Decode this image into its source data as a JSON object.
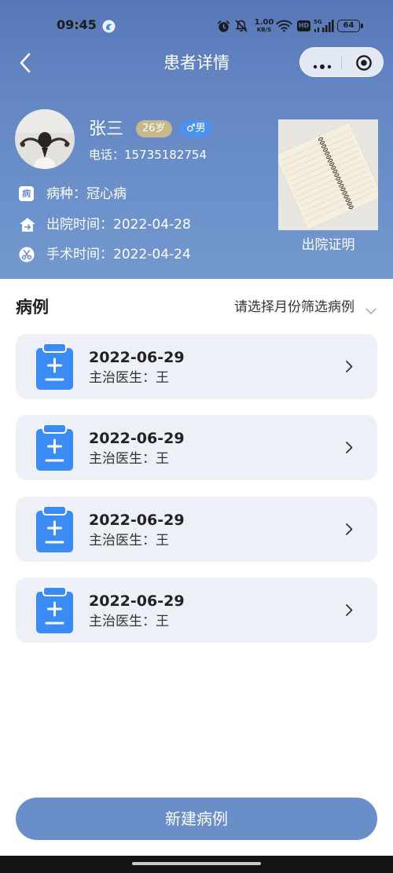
{
  "status_bar": {
    "time": "09:45",
    "net_speed_value": "1.00",
    "net_speed_unit": "KB/S",
    "hd_label": "HD",
    "network_type": "5G",
    "battery_level": "64",
    "icons": [
      "app-notification-icon",
      "alarm-icon",
      "mute-icon",
      "wifi-icon",
      "signal-icon",
      "battery-icon"
    ]
  },
  "header": {
    "title": "患者详情",
    "icons": {
      "back": "chevron-left-icon",
      "more": "more-dots-icon",
      "close": "target-close-icon"
    }
  },
  "patient": {
    "name": "张三",
    "age_badge": "26岁",
    "gender_badge": "♂男",
    "phone_label": "电话：",
    "phone": "15735182754",
    "rows": [
      {
        "icon": "disease-icon",
        "icon_glyph": "病",
        "label": "病种：",
        "value": "冠心病"
      },
      {
        "icon": "discharge-icon",
        "label": "出院时间：",
        "value": "2022-04-28"
      },
      {
        "icon": "surgery-icon",
        "label": "手术时间：",
        "value": "2022-04-24"
      }
    ],
    "certificate_caption": "出院证明"
  },
  "cases": {
    "title": "病例",
    "filter_placeholder": "请选择月份筛选病例",
    "items": [
      {
        "date": "2022-06-29",
        "doctor_label": "主治医生：",
        "doctor": "王"
      },
      {
        "date": "2022-06-29",
        "doctor_label": "主治医生：",
        "doctor": "王"
      },
      {
        "date": "2022-06-29",
        "doctor_label": "主治医生：",
        "doctor": "王"
      },
      {
        "date": "2022-06-29",
        "doctor_label": "主治医生：",
        "doctor": "王"
      }
    ]
  },
  "new_case_button": "新建病例",
  "colors": {
    "header_top": "#5877b7",
    "header_mid": "#6386c3",
    "header_bottom": "#7398cf",
    "card_bg": "#edf0f7",
    "button_bg": "#6a8ec7",
    "clipboard_blue": "#3a8cf4",
    "age_badge_bg": "#c8b78b",
    "gender_badge_bg": "#4e92ef"
  }
}
